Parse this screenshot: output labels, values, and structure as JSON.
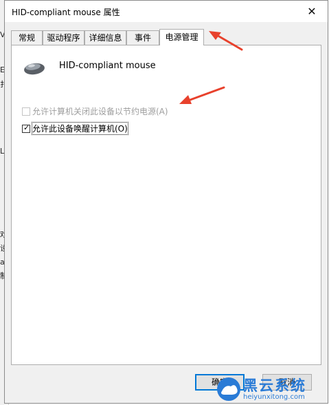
{
  "window": {
    "title": "HID-compliant mouse 属性",
    "close_glyph": "✕"
  },
  "tabs": [
    {
      "label": "常规",
      "active": false
    },
    {
      "label": "驱动程序",
      "active": false
    },
    {
      "label": "详细信息",
      "active": false
    },
    {
      "label": "事件",
      "active": false
    },
    {
      "label": "电源管理",
      "active": true
    }
  ],
  "device": {
    "name": "HID-compliant mouse",
    "icon": "mouse-icon"
  },
  "options": [
    {
      "label": "允许计算机关闭此设备以节约电源(A)",
      "checked": false,
      "enabled": false
    },
    {
      "label": "允许此设备唤醒计算机(O)",
      "checked": true,
      "enabled": true
    }
  ],
  "buttons": {
    "ok": "确定",
    "cancel": "取消"
  },
  "background_fragments": [
    "V",
    "E",
    "扌",
    "LP",
    "戏",
    "设",
    "a",
    "制"
  ],
  "watermark": {
    "name": "黑云系统",
    "url": "heiyunxitong.com"
  },
  "colors": {
    "accent": "#0078d7",
    "arrow": "#e8412c",
    "watermark": "#2a7bd6"
  }
}
